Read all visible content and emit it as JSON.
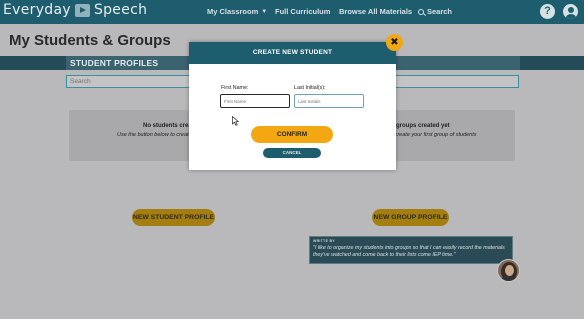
{
  "nav": {
    "brand_left": "Everyday",
    "brand_right": "Speech",
    "my_classroom": "My Classroom",
    "full_curriculum": "Full Curriculum",
    "browse_all": "Browse All Materials",
    "search": "Search",
    "help_glyph": "?"
  },
  "page": {
    "title": "My Students & Groups"
  },
  "students": {
    "section_title": "STUDENT PROFILES",
    "search_placeholder": "Search",
    "empty_title": "No students create",
    "empty_sub": "Use the button below to create",
    "new_button": "NEW STUDENT PROFILE"
  },
  "groups": {
    "empty_title": "groups created yet",
    "empty_sub": "o create your first group of students",
    "new_button": "NEW GROUP PROFILE"
  },
  "tip": {
    "label": "WRITTE BY",
    "quote": "\"I like to organize my students into groups so that I can easily record the materials they've watched and come back to their lists come IEP time.\""
  },
  "modal": {
    "title": "CREATE NEW STUDENT",
    "close_glyph": "✖",
    "first_name_label": "First Name:",
    "first_name_placeholder": "First Name",
    "first_name_value": "",
    "last_initial_label": "Last Initial(s):",
    "last_initial_placeholder": "Last Initials",
    "last_initial_value": "",
    "confirm": "CONFIRM",
    "cancel": "CANCEL"
  },
  "colors": {
    "nav": "#1d5d6e",
    "accent": "#f3a712",
    "overlay_bg": "#b9b9bb"
  },
  "icons": [
    "play-logo-icon",
    "chevron-down-icon",
    "search-icon",
    "help-icon",
    "user-icon",
    "close-icon",
    "cursor-icon"
  ]
}
